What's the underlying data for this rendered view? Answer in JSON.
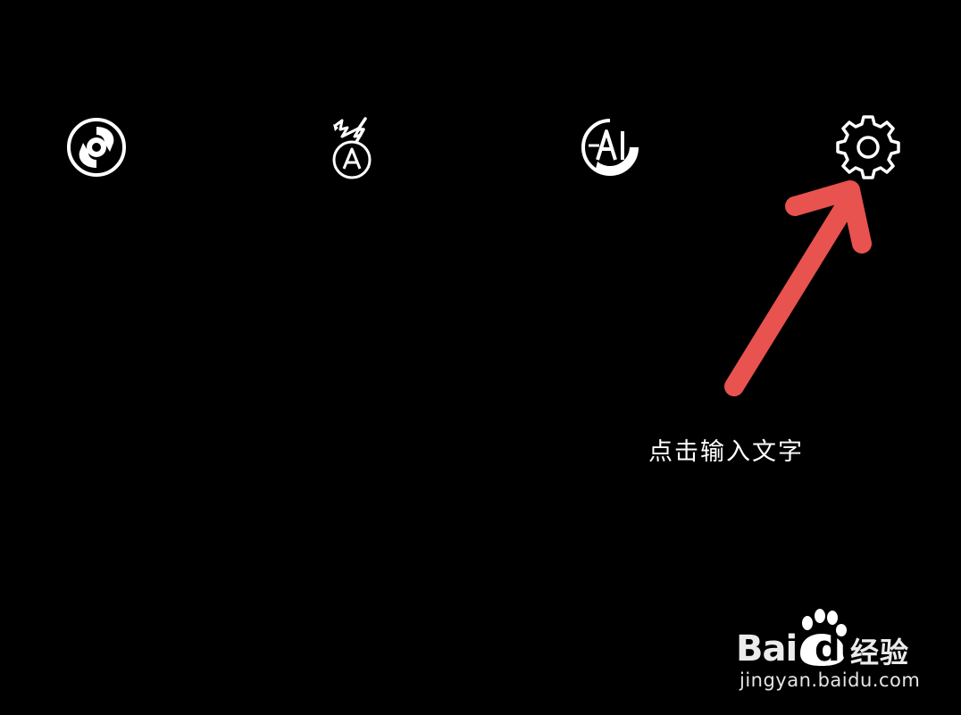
{
  "toolbar": {
    "buttons": [
      {
        "id": "filter",
        "icon": "filter-swirl-icon"
      },
      {
        "id": "flash",
        "icon": "flash-auto-icon"
      },
      {
        "id": "ai",
        "icon": "ai-scene-icon"
      },
      {
        "id": "settings",
        "icon": "gear-icon"
      }
    ]
  },
  "annotation": {
    "text": "点击输入文字",
    "arrow_color": "#e8524f"
  },
  "watermark": {
    "brand_prefix": "Bai",
    "brand_du": "du",
    "brand_suffix": "经验",
    "url": "jingyan.baidu.com"
  },
  "colors": {
    "background": "#000000",
    "icon": "#ffffff",
    "accent": "#e8524f"
  }
}
